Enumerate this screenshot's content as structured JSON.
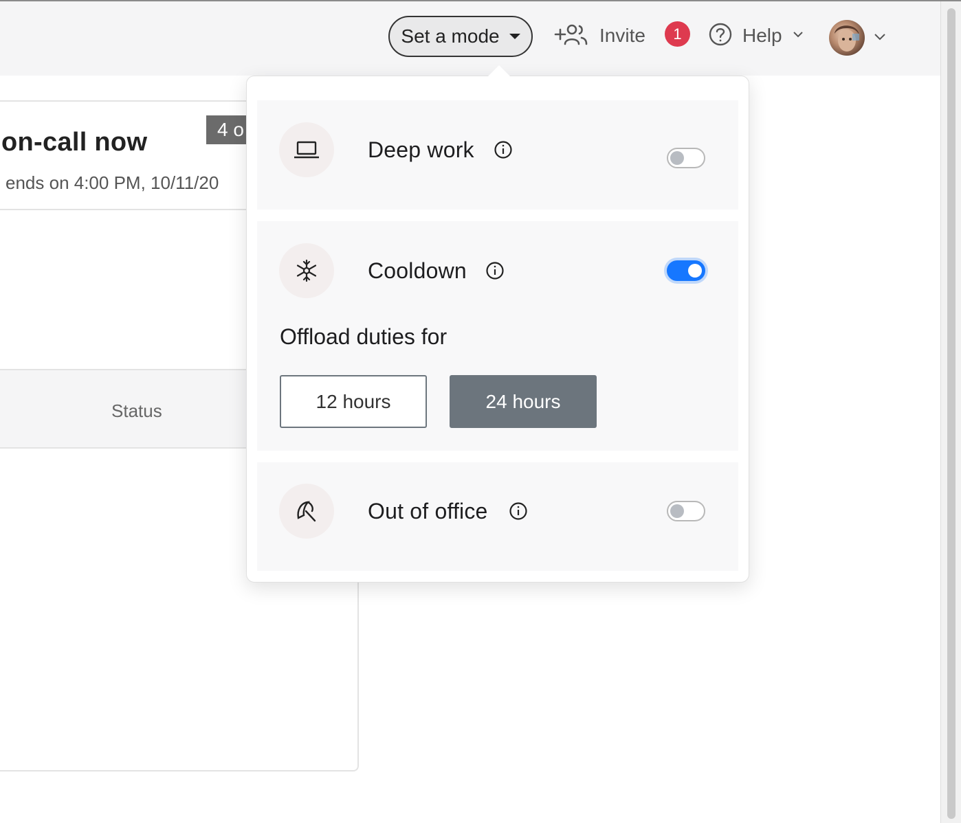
{
  "header": {
    "mode_button": "Set a mode",
    "invite_label": "Invite",
    "notification_count": "1",
    "help_label": "Help"
  },
  "background_card": {
    "title": "on-call now",
    "subtitle": "ends on 4:00 PM, 10/11/20",
    "count_badge": "4 o",
    "status_header": "Status"
  },
  "modes": {
    "deep_work": {
      "label": "Deep work",
      "enabled": false,
      "icon": "laptop-icon"
    },
    "cooldown": {
      "label": "Cooldown",
      "enabled": true,
      "icon": "snowflake-icon",
      "offload_label": "Offload duties for",
      "options": [
        "12 hours",
        "24 hours"
      ],
      "selected": "24 hours"
    },
    "out_of_office": {
      "label": "Out of office",
      "enabled": false,
      "icon": "umbrella-icon"
    }
  },
  "colors": {
    "toggle_on": "#1677ff",
    "selected_duration": "#6c757d",
    "notification_badge": "#de3a4f"
  }
}
